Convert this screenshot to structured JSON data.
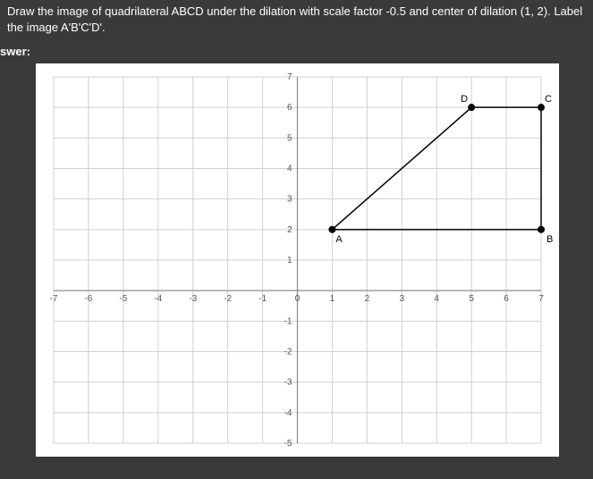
{
  "instruction_line1": "Draw the image of quadrilateral ABCD under the dilation with scale factor -0.5 and center of dilation (1, 2). Label",
  "instruction_line2": "the image A'B'C'D'.",
  "answer_label": "swer:",
  "chart_data": {
    "type": "scatter",
    "title": "",
    "xlabel": "",
    "ylabel": "",
    "xlim": [
      -7,
      7
    ],
    "ylim": [
      -5,
      7
    ],
    "x_ticks": [
      -7,
      -6,
      -5,
      -4,
      -3,
      -2,
      -1,
      0,
      1,
      2,
      3,
      4,
      5,
      6,
      7
    ],
    "y_ticks": [
      -5,
      -4,
      -3,
      -2,
      -1,
      0,
      1,
      2,
      3,
      4,
      5,
      6,
      7
    ],
    "grid": true,
    "series": [
      {
        "name": "ABCD",
        "points": [
          {
            "label": "A",
            "x": 1,
            "y": 2
          },
          {
            "label": "B",
            "x": 7,
            "y": 2
          },
          {
            "label": "C",
            "x": 7,
            "y": 6
          },
          {
            "label": "D",
            "x": 5,
            "y": 6
          }
        ],
        "closed": true
      }
    ],
    "center_of_dilation": {
      "x": 1,
      "y": 2
    },
    "scale_factor": -0.5
  }
}
